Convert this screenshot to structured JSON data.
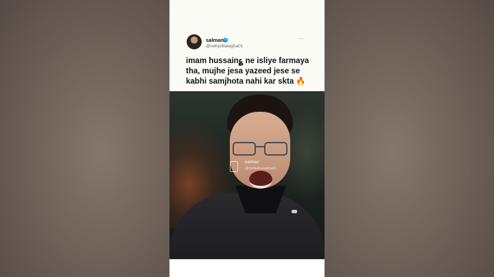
{
  "tweet": {
    "user_name": "salman",
    "verified_icon": "verified-badge-icon",
    "handle": "@nehjulbalagha01",
    "more_icon": "⋯",
    "text_lines": [
      "imam hussain؏ ne isliye farmaya",
      "tha, mujhe jesa yazeed jese se",
      "kabhi samjhota nahi kar skta 🔥"
    ]
  },
  "video_watermark": {
    "name": "salman",
    "handle": "@nehjulbalagha01"
  },
  "colors": {
    "verified": "#1d9bf0",
    "card_bg": "#fbfbf6",
    "side_bg": "#6f635c"
  }
}
